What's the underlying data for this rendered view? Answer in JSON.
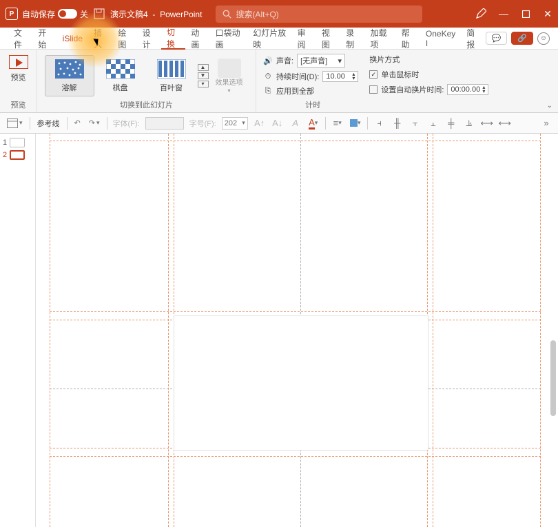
{
  "title_bar": {
    "app_initial": "P",
    "autosave_label": "自动保存",
    "autosave_state": "关",
    "doc_name": "演示文稿4",
    "app_name": "PowerPoint",
    "search_placeholder": "搜索(Alt+Q)"
  },
  "tabs": {
    "items": [
      "文件",
      "开始",
      "iSlide",
      "插入",
      "绘图",
      "设计",
      "切换",
      "动画",
      "口袋动画",
      "幻灯片放映",
      "审阅",
      "视图",
      "录制",
      "加载项",
      "帮助",
      "OneKey I",
      "简报"
    ],
    "active_index": 6
  },
  "ribbon": {
    "preview": {
      "label": "预览",
      "group_label": "预览"
    },
    "transitions": {
      "items": [
        {
          "name": "溶解",
          "icon": "dissolve"
        },
        {
          "name": "棋盘",
          "icon": "checker"
        },
        {
          "name": "百叶窗",
          "icon": "blinds"
        }
      ],
      "selected_index": 0,
      "group_label": "切换到此幻灯片",
      "effect_options_label": "效果选项"
    },
    "timing": {
      "sound_label": "声音:",
      "sound_value": "[无声音]",
      "duration_label": "持续时间(D):",
      "duration_value": "10.00",
      "apply_all_label": "应用到全部",
      "group_label": "计时"
    },
    "advance": {
      "title": "换片方式",
      "on_click_label": "单击鼠标时",
      "on_click_checked": true,
      "auto_label": "设置自动换片时间:",
      "auto_checked": false,
      "auto_value": "00:00.00"
    }
  },
  "quickbar": {
    "guides_label": "参考线",
    "font_label": "字体(F):",
    "fontsize_label": "字号(F):",
    "fontsize_value": "202"
  },
  "thumbnails": {
    "slides": [
      {
        "num": "1",
        "active": false
      },
      {
        "num": "2",
        "active": true
      }
    ]
  }
}
